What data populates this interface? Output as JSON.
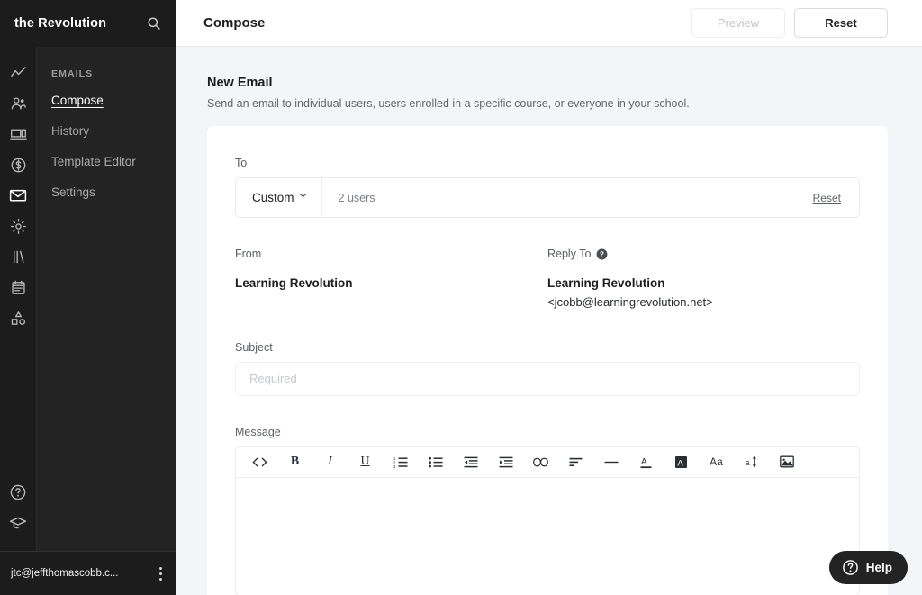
{
  "sidebar": {
    "brand": "the Revolution",
    "search_icon": "search-icon",
    "rail_icons": [
      {
        "name": "analytics-icon",
        "label": "Analytics"
      },
      {
        "name": "people-icon",
        "label": "People"
      },
      {
        "name": "devices-icon",
        "label": "Site"
      },
      {
        "name": "money-icon",
        "label": "Commerce"
      },
      {
        "name": "mail-icon",
        "label": "Emails"
      },
      {
        "name": "gear-icon",
        "label": "Settings"
      },
      {
        "name": "books-icon",
        "label": "Library"
      },
      {
        "name": "calendar-icon",
        "label": "Events"
      },
      {
        "name": "shapes-icon",
        "label": "Design"
      }
    ],
    "rail_bottom_icons": [
      {
        "name": "help-circle-icon",
        "label": "Help"
      },
      {
        "name": "graduation-cap-icon",
        "label": "Learn"
      }
    ],
    "section_title": "EMAILS",
    "items": [
      {
        "label": "Compose",
        "active": true
      },
      {
        "label": "History",
        "active": false
      },
      {
        "label": "Template Editor",
        "active": false
      },
      {
        "label": "Settings",
        "active": false
      }
    ],
    "footer": {
      "user_email": "jtc@jeffthomascobb.c...",
      "kebab_icon": "kebab-menu-icon"
    }
  },
  "topbar": {
    "title": "Compose",
    "preview_label": "Preview",
    "reset_label": "Reset"
  },
  "main": {
    "section_title": "New Email",
    "section_subtitle": "Send an email to individual users, users enrolled in a specific course, or everyone in your school.",
    "to": {
      "label": "To",
      "select_value": "Custom",
      "chevron_icon": "chevron-down-icon",
      "recipients": "2 users",
      "reset_label": "Reset"
    },
    "from": {
      "label": "From",
      "value": "Learning Revolution"
    },
    "reply_to": {
      "label": "Reply To",
      "help_icon": "help-circle-icon",
      "value": "Learning Revolution",
      "email": "<jcobb@learningrevolution.net>"
    },
    "subject": {
      "label": "Subject",
      "value": "",
      "placeholder": "Required"
    },
    "message": {
      "label": "Message",
      "value": "",
      "toolbar": [
        {
          "name": "code-icon",
          "label": "Code"
        },
        {
          "name": "bold-icon",
          "label": "B"
        },
        {
          "name": "italic-icon",
          "label": "I"
        },
        {
          "name": "underline-icon",
          "label": "U"
        },
        {
          "name": "ordered-list-icon",
          "label": "Numbered list"
        },
        {
          "name": "unordered-list-icon",
          "label": "Bulleted list"
        },
        {
          "name": "outdent-icon",
          "label": "Outdent"
        },
        {
          "name": "indent-icon",
          "label": "Indent"
        },
        {
          "name": "link-icon",
          "label": "Link"
        },
        {
          "name": "align-left-icon",
          "label": "Align"
        },
        {
          "name": "horizontal-rule-icon",
          "label": "Horizontal rule"
        },
        {
          "name": "text-color-icon",
          "label": "Text color"
        },
        {
          "name": "background-color-icon",
          "label": "Background color"
        },
        {
          "name": "font-family-icon",
          "label": "Aa"
        },
        {
          "name": "font-size-icon",
          "label": "Font size"
        },
        {
          "name": "image-icon",
          "label": "Image"
        }
      ]
    }
  },
  "help_fab": {
    "icon": "help-circle-icon",
    "label": "Help"
  },
  "colors": {
    "sidebar_bg": "#232323",
    "rail_bg": "#1c1c1c",
    "page_bg": "#f4f5f7",
    "card_bg": "#ffffff",
    "text_primary": "#1d1d1f",
    "text_muted": "#7d8085"
  }
}
